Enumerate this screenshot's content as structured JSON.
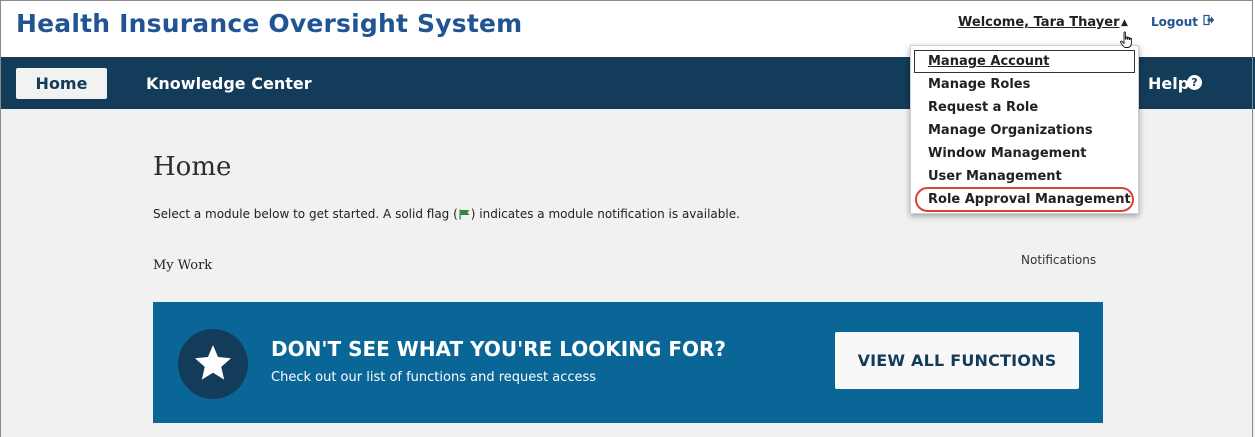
{
  "header": {
    "title": "Health Insurance Oversight System",
    "welcome": "Welcome, Tara Thayer",
    "logout": "Logout"
  },
  "nav": {
    "home": "Home",
    "knowledge_center": "Knowledge Center",
    "help": "Help",
    "help_icon": "?"
  },
  "dropdown": {
    "items": [
      {
        "label": "Manage Account"
      },
      {
        "label": "Manage Roles"
      },
      {
        "label": "Request a Role"
      },
      {
        "label": "Manage Organizations"
      },
      {
        "label": "Window Management"
      },
      {
        "label": "User Management"
      },
      {
        "label": "Role Approval Management"
      }
    ]
  },
  "main": {
    "page_title": "Home",
    "intro_before": "Select a module below to get started. A solid flag (",
    "intro_after": ") indicates a module notification is available.",
    "my_work": "My Work",
    "notifications": "Notifications"
  },
  "banner": {
    "heading": "DON'T SEE WHAT YOU'RE LOOKING FOR?",
    "subtext": "Check out our list of functions and request access",
    "button": "VIEW ALL FUNCTIONS"
  },
  "icons": {
    "caret": "caret-up-icon",
    "cursor": "hand-pointer-icon",
    "logout": "logout-icon",
    "help": "question-circle-icon",
    "flag": "flag-icon",
    "star": "star-icon"
  },
  "colors": {
    "brand_blue": "#205493",
    "nav_navy": "#133c5a",
    "banner_blue": "#0b6698",
    "flag_green": "#2e8540",
    "highlight_red": "#d9423a"
  }
}
